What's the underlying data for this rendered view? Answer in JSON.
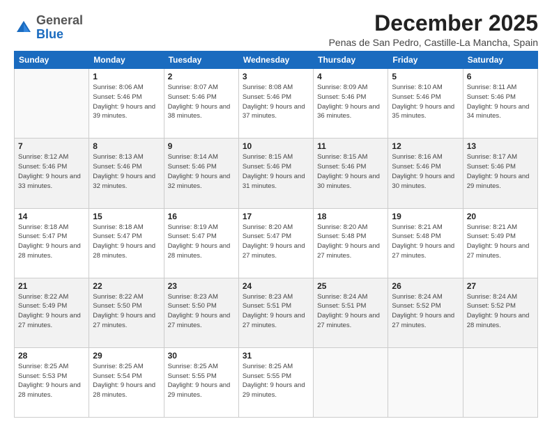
{
  "logo": {
    "general": "General",
    "blue": "Blue"
  },
  "title": "December 2025",
  "location": "Penas de San Pedro, Castille-La Mancha, Spain",
  "days_of_week": [
    "Sunday",
    "Monday",
    "Tuesday",
    "Wednesday",
    "Thursday",
    "Friday",
    "Saturday"
  ],
  "weeks": [
    [
      {
        "day": "",
        "sunrise": "",
        "sunset": "",
        "daylight": ""
      },
      {
        "day": "1",
        "sunrise": "Sunrise: 8:06 AM",
        "sunset": "Sunset: 5:46 PM",
        "daylight": "Daylight: 9 hours and 39 minutes."
      },
      {
        "day": "2",
        "sunrise": "Sunrise: 8:07 AM",
        "sunset": "Sunset: 5:46 PM",
        "daylight": "Daylight: 9 hours and 38 minutes."
      },
      {
        "day": "3",
        "sunrise": "Sunrise: 8:08 AM",
        "sunset": "Sunset: 5:46 PM",
        "daylight": "Daylight: 9 hours and 37 minutes."
      },
      {
        "day": "4",
        "sunrise": "Sunrise: 8:09 AM",
        "sunset": "Sunset: 5:46 PM",
        "daylight": "Daylight: 9 hours and 36 minutes."
      },
      {
        "day": "5",
        "sunrise": "Sunrise: 8:10 AM",
        "sunset": "Sunset: 5:46 PM",
        "daylight": "Daylight: 9 hours and 35 minutes."
      },
      {
        "day": "6",
        "sunrise": "Sunrise: 8:11 AM",
        "sunset": "Sunset: 5:46 PM",
        "daylight": "Daylight: 9 hours and 34 minutes."
      }
    ],
    [
      {
        "day": "7",
        "sunrise": "Sunrise: 8:12 AM",
        "sunset": "Sunset: 5:46 PM",
        "daylight": "Daylight: 9 hours and 33 minutes."
      },
      {
        "day": "8",
        "sunrise": "Sunrise: 8:13 AM",
        "sunset": "Sunset: 5:46 PM",
        "daylight": "Daylight: 9 hours and 32 minutes."
      },
      {
        "day": "9",
        "sunrise": "Sunrise: 8:14 AM",
        "sunset": "Sunset: 5:46 PM",
        "daylight": "Daylight: 9 hours and 32 minutes."
      },
      {
        "day": "10",
        "sunrise": "Sunrise: 8:15 AM",
        "sunset": "Sunset: 5:46 PM",
        "daylight": "Daylight: 9 hours and 31 minutes."
      },
      {
        "day": "11",
        "sunrise": "Sunrise: 8:15 AM",
        "sunset": "Sunset: 5:46 PM",
        "daylight": "Daylight: 9 hours and 30 minutes."
      },
      {
        "day": "12",
        "sunrise": "Sunrise: 8:16 AM",
        "sunset": "Sunset: 5:46 PM",
        "daylight": "Daylight: 9 hours and 30 minutes."
      },
      {
        "day": "13",
        "sunrise": "Sunrise: 8:17 AM",
        "sunset": "Sunset: 5:46 PM",
        "daylight": "Daylight: 9 hours and 29 minutes."
      }
    ],
    [
      {
        "day": "14",
        "sunrise": "Sunrise: 8:18 AM",
        "sunset": "Sunset: 5:47 PM",
        "daylight": "Daylight: 9 hours and 28 minutes."
      },
      {
        "day": "15",
        "sunrise": "Sunrise: 8:18 AM",
        "sunset": "Sunset: 5:47 PM",
        "daylight": "Daylight: 9 hours and 28 minutes."
      },
      {
        "day": "16",
        "sunrise": "Sunrise: 8:19 AM",
        "sunset": "Sunset: 5:47 PM",
        "daylight": "Daylight: 9 hours and 28 minutes."
      },
      {
        "day": "17",
        "sunrise": "Sunrise: 8:20 AM",
        "sunset": "Sunset: 5:47 PM",
        "daylight": "Daylight: 9 hours and 27 minutes."
      },
      {
        "day": "18",
        "sunrise": "Sunrise: 8:20 AM",
        "sunset": "Sunset: 5:48 PM",
        "daylight": "Daylight: 9 hours and 27 minutes."
      },
      {
        "day": "19",
        "sunrise": "Sunrise: 8:21 AM",
        "sunset": "Sunset: 5:48 PM",
        "daylight": "Daylight: 9 hours and 27 minutes."
      },
      {
        "day": "20",
        "sunrise": "Sunrise: 8:21 AM",
        "sunset": "Sunset: 5:49 PM",
        "daylight": "Daylight: 9 hours and 27 minutes."
      }
    ],
    [
      {
        "day": "21",
        "sunrise": "Sunrise: 8:22 AM",
        "sunset": "Sunset: 5:49 PM",
        "daylight": "Daylight: 9 hours and 27 minutes."
      },
      {
        "day": "22",
        "sunrise": "Sunrise: 8:22 AM",
        "sunset": "Sunset: 5:50 PM",
        "daylight": "Daylight: 9 hours and 27 minutes."
      },
      {
        "day": "23",
        "sunrise": "Sunrise: 8:23 AM",
        "sunset": "Sunset: 5:50 PM",
        "daylight": "Daylight: 9 hours and 27 minutes."
      },
      {
        "day": "24",
        "sunrise": "Sunrise: 8:23 AM",
        "sunset": "Sunset: 5:51 PM",
        "daylight": "Daylight: 9 hours and 27 minutes."
      },
      {
        "day": "25",
        "sunrise": "Sunrise: 8:24 AM",
        "sunset": "Sunset: 5:51 PM",
        "daylight": "Daylight: 9 hours and 27 minutes."
      },
      {
        "day": "26",
        "sunrise": "Sunrise: 8:24 AM",
        "sunset": "Sunset: 5:52 PM",
        "daylight": "Daylight: 9 hours and 27 minutes."
      },
      {
        "day": "27",
        "sunrise": "Sunrise: 8:24 AM",
        "sunset": "Sunset: 5:52 PM",
        "daylight": "Daylight: 9 hours and 28 minutes."
      }
    ],
    [
      {
        "day": "28",
        "sunrise": "Sunrise: 8:25 AM",
        "sunset": "Sunset: 5:53 PM",
        "daylight": "Daylight: 9 hours and 28 minutes."
      },
      {
        "day": "29",
        "sunrise": "Sunrise: 8:25 AM",
        "sunset": "Sunset: 5:54 PM",
        "daylight": "Daylight: 9 hours and 28 minutes."
      },
      {
        "day": "30",
        "sunrise": "Sunrise: 8:25 AM",
        "sunset": "Sunset: 5:55 PM",
        "daylight": "Daylight: 9 hours and 29 minutes."
      },
      {
        "day": "31",
        "sunrise": "Sunrise: 8:25 AM",
        "sunset": "Sunset: 5:55 PM",
        "daylight": "Daylight: 9 hours and 29 minutes."
      },
      {
        "day": "",
        "sunrise": "",
        "sunset": "",
        "daylight": ""
      },
      {
        "day": "",
        "sunrise": "",
        "sunset": "",
        "daylight": ""
      },
      {
        "day": "",
        "sunrise": "",
        "sunset": "",
        "daylight": ""
      }
    ]
  ]
}
